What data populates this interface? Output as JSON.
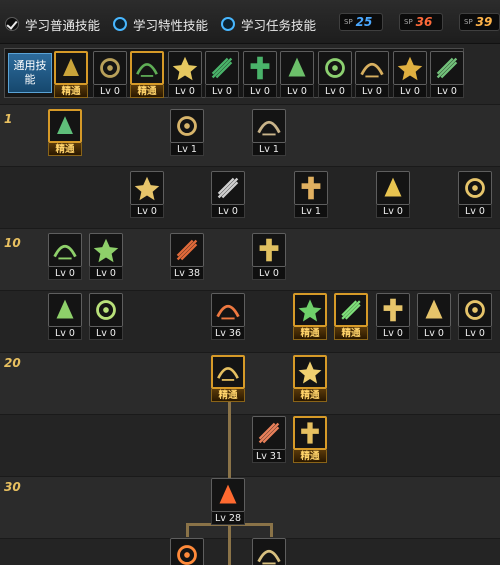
{
  "filters": [
    {
      "label": "学习普通技能",
      "state": "checked"
    },
    {
      "label": "学习特性技能",
      "state": "radio"
    },
    {
      "label": "学习任务技能",
      "state": "radio"
    }
  ],
  "sp_badges": [
    {
      "label": "SP",
      "value": "25",
      "color": "#4aa8ff"
    },
    {
      "label": "SP",
      "value": "36",
      "color": "#ff6a3a"
    },
    {
      "label": "SP",
      "value": "39",
      "color": "#ffb44a"
    }
  ],
  "common": {
    "label": "通用技能"
  },
  "level_markers": [
    "1",
    "10",
    "20",
    "30"
  ],
  "colors": {
    "gold": "#d69a28",
    "lv_text": "#f0f0f0",
    "master_text": "#ffd36a",
    "level_marker": "#e8c060"
  },
  "common_skills": [
    {
      "icon": "common-skill-1-icon",
      "color": "#caa43a",
      "cap": "精通"
    },
    {
      "icon": "common-skill-2-icon",
      "color": "#b8a05a",
      "cap": "Lv 0"
    },
    {
      "icon": "common-skill-3-icon",
      "color": "#5fae56",
      "cap": "精通"
    },
    {
      "icon": "common-skill-4-icon",
      "color": "#e6c860",
      "cap": "Lv 0"
    },
    {
      "icon": "common-skill-5-icon",
      "color": "#4ab36a",
      "cap": "Lv 0"
    },
    {
      "icon": "common-skill-6-icon",
      "color": "#4ab36a",
      "cap": "Lv 0"
    },
    {
      "icon": "common-skill-7-icon",
      "color": "#6cc06a",
      "cap": "Lv 0"
    },
    {
      "icon": "common-skill-8-icon",
      "color": "#8cd070",
      "cap": "Lv 0"
    },
    {
      "icon": "common-skill-9-icon",
      "color": "#d8b060",
      "cap": "Lv 0"
    },
    {
      "icon": "common-skill-10-icon",
      "color": "#e0b040",
      "cap": "Lv 0"
    },
    {
      "icon": "common-skill-11-icon",
      "color": "#72c07a",
      "cap": "Lv 0"
    }
  ],
  "tree": [
    {
      "icon": "skill-icon",
      "color": "#5fbf7a",
      "cap": "精通"
    },
    {
      "icon": "skill-icon",
      "color": "#d7b46a",
      "cap": "Lv 1"
    },
    {
      "icon": "skill-icon",
      "color": "#c9b48a",
      "cap": "Lv 1"
    },
    {
      "icon": "skill-icon",
      "color": "#e6c46a",
      "cap": "Lv 0"
    },
    {
      "icon": "skill-icon",
      "color": "#cfcfcf",
      "cap": "Lv 0"
    },
    {
      "icon": "skill-icon",
      "color": "#e0b060",
      "cap": "Lv 1"
    },
    {
      "icon": "skill-icon",
      "color": "#e8c450",
      "cap": "Lv 0"
    },
    {
      "icon": "skill-icon",
      "color": "#e6c46a",
      "cap": "Lv 0"
    },
    {
      "icon": "skill-icon",
      "color": "#8ed06a",
      "cap": "Lv 0"
    },
    {
      "icon": "skill-icon",
      "color": "#8ed06a",
      "cap": "Lv 0"
    },
    {
      "icon": "skill-icon",
      "color": "#e06a3a",
      "cap": "Lv 38"
    },
    {
      "icon": "skill-icon",
      "color": "#e0c060",
      "cap": "Lv 0"
    },
    {
      "icon": "skill-icon",
      "color": "#8ed06a",
      "cap": "Lv 0"
    },
    {
      "icon": "skill-icon",
      "color": "#b8e07a",
      "cap": "Lv 0"
    },
    {
      "icon": "skill-icon",
      "color": "#ee7840",
      "cap": "Lv 36"
    },
    {
      "icon": "skill-icon",
      "color": "#6fd06a",
      "cap": "精通"
    },
    {
      "icon": "skill-icon",
      "color": "#7fe07a",
      "cap": "精通"
    },
    {
      "icon": "skill-icon",
      "color": "#e6c46a",
      "cap": "Lv 0"
    },
    {
      "icon": "skill-icon",
      "color": "#e6c46a",
      "cap": "Lv 0"
    },
    {
      "icon": "skill-icon",
      "color": "#e6c46a",
      "cap": "Lv 0"
    },
    {
      "icon": "skill-icon",
      "color": "#e6c060",
      "cap": "精通"
    },
    {
      "icon": "skill-icon",
      "color": "#f0d070",
      "cap": "精通"
    },
    {
      "icon": "skill-icon",
      "color": "#e8805a",
      "cap": "Lv 31"
    },
    {
      "icon": "skill-icon",
      "color": "#e6c060",
      "cap": "精通"
    },
    {
      "icon": "skill-icon",
      "color": "#ff6a30",
      "cap": "Lv 28"
    },
    {
      "icon": "skill-icon",
      "color": "#ff8a3a",
      "cap": ""
    },
    {
      "icon": "skill-icon",
      "color": "#d8c080",
      "cap": ""
    }
  ]
}
